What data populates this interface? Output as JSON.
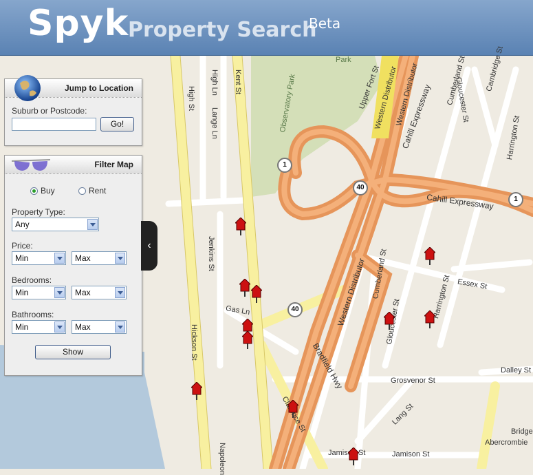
{
  "header": {
    "brand": "Spyk",
    "subtitle": "Property Search",
    "beta": "Beta"
  },
  "jump_panel": {
    "title": "Jump to Location",
    "label": "Suburb or Postcode:",
    "input_value": "",
    "go_label": "Go!"
  },
  "filter_panel": {
    "title": "Filter Map",
    "buy_label": "Buy",
    "rent_label": "Rent",
    "selected_mode": "Buy",
    "property_type_label": "Property Type:",
    "property_type_value": "Any",
    "price_label": "Price:",
    "bedrooms_label": "Bedrooms:",
    "bathrooms_label": "Bathrooms:",
    "min_label": "Min",
    "max_label": "Max",
    "show_label": "Show"
  },
  "map": {
    "street_labels": [
      "High St",
      "High Ln",
      "Lange Ln",
      "Kent St",
      "Observatory Park",
      "Park",
      "Upper Fort St",
      "Western Distributor",
      "Western Distributor",
      "Cahill Expressway",
      "Cumberland St",
      "Gloucester St",
      "Cambridge St",
      "Harrington St",
      "Cahill Expressway",
      "Jenkins St",
      "Gas Ln",
      "Cumberland St",
      "Essex St",
      "Harrington St",
      "Gloucester St",
      "Western Distributor",
      "Bradfield Hwy",
      "Hickson St",
      "Grosvenor St",
      "Dalley St",
      "Lang St",
      "Bridge",
      "Abercrombie",
      "Clarence St",
      "Jamison St",
      "Jamison St",
      "Napoleon"
    ],
    "route_shields": [
      "1",
      "40",
      "1",
      "40"
    ]
  },
  "colors": {
    "header": "#6a8fbd",
    "highway": "#f0a060",
    "major_road": "#f8f0a0",
    "park": "#d4dfb8",
    "water": "#b3c9dc",
    "marker": "#cc1111"
  }
}
